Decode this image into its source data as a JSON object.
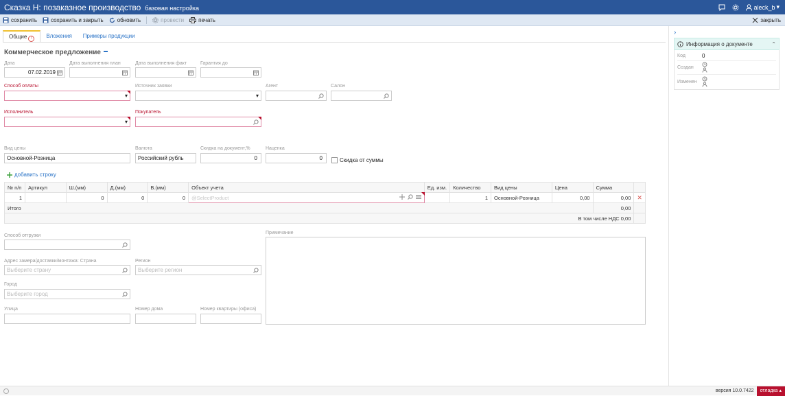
{
  "window": {
    "title": "Сказка Н: позаказное производство",
    "subtitle": "базовая настройка",
    "user": "aleck_b"
  },
  "toolbar": {
    "save": "сохранить",
    "save_close": "сохранить и закрыть",
    "refresh": "обновить",
    "post": "провести",
    "print": "печать",
    "close": "закрыть"
  },
  "tabs": {
    "general": "Общие",
    "attachments": "Вложения",
    "examples": "Примеры продукции"
  },
  "form": {
    "section_title": "Коммерческое предложение",
    "date_label": "Дата",
    "date_value": "07.02.2019",
    "plan_label": "Дата выполнения план",
    "fact_label": "Дата выполнения факт",
    "warranty_label": "Гарантия до",
    "payment_label": "Способ оплаты",
    "source_label": "Источник заявки",
    "agent_label": "Агент",
    "salon_label": "Салон",
    "executor_label": "Исполнитель",
    "buyer_label": "Покупатель",
    "price_type_label": "Вид цены",
    "price_type_value": "Основной-Розница",
    "currency_label": "Валюта",
    "currency_value": "Российский рубль",
    "discount_label": "Скидка на документ,%",
    "discount_value": "0",
    "markup_label": "Наценка",
    "markup_value": "0",
    "discount_sum_label": "Скидка от суммы",
    "add_row": "добавить строку"
  },
  "table": {
    "headers": [
      "№ п/п",
      "Артикул",
      "Ш.(мм)",
      "Д.(мм)",
      "В.(мм)",
      "Объект учета",
      "Ед. изм.",
      "Количество",
      "Вид цены",
      "Цена",
      "Сумма"
    ],
    "row": {
      "num": "1",
      "article": "",
      "width": "0",
      "length": "0",
      "height": "0",
      "object_placeholder": "@SelectProduct",
      "unit": "",
      "qty": "1",
      "price_type": "Основной-Розница",
      "price": "0,00",
      "sum": "0,00"
    },
    "total_label": "Итого",
    "total_value": "0,00",
    "vat_label": "В том числе НДС 0,00"
  },
  "delivery": {
    "shipping_label": "Способ отгрузки",
    "country_label": "Адрес замера/доставки/монтажа: Страна",
    "country_placeholder": "Выберите страну",
    "region_label": "Регион",
    "region_placeholder": "Выберите регион",
    "city_label": "Город",
    "city_placeholder": "Выберите город",
    "street_label": "Улица",
    "house_label": "Номер дома",
    "apartment_label": "Номер квартиры (офиса)",
    "note_label": "Примечание"
  },
  "info": {
    "title": "Информация о документе",
    "code_label": "Код",
    "code_value": "0",
    "created_label": "Создан",
    "modified_label": "Изменен"
  },
  "status": {
    "version": "версия 10.0.7422",
    "debug": "отладка"
  }
}
